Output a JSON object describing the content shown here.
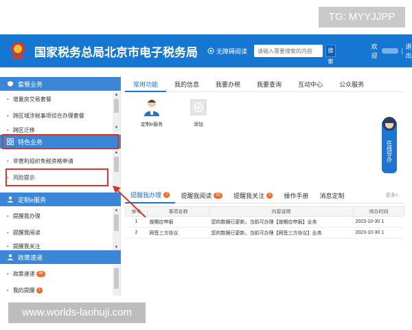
{
  "watermark_top": "TG: MYYJJPP",
  "watermark_bottom": "www.worlds-laohuji.com",
  "header": {
    "title": "国家税务总局北京市电子税务局",
    "barrier_free": "无障碍阅读",
    "search_placeholder": "请输入需要搜索的内容",
    "search_button": "搜索",
    "welcome": "欢迎",
    "separator": "|",
    "logout": "退出",
    "color": "#1677d2"
  },
  "sidebar": {
    "sections": [
      {
        "title": "套餐业务",
        "icon": "shield-icon",
        "items": [
          {
            "label": "增量房交易套餐"
          },
          {
            "label": "跨区域涉税事项综合办理套餐"
          },
          {
            "label": "跨区迁移"
          }
        ]
      },
      {
        "title": "特色业务",
        "icon": "grid-icon",
        "items": [
          {
            "label": "非营利组织免税资格申请"
          },
          {
            "label": "风险提示"
          }
        ]
      },
      {
        "title": "定制e服务",
        "icon": "user-icon",
        "items": [
          {
            "label": "提醒我办理"
          },
          {
            "label": "提醒我阅读"
          },
          {
            "label": "提醒我关注"
          }
        ]
      },
      {
        "title": "政策速递",
        "icon": "user-icon",
        "items": [
          {
            "label": "政策速递",
            "badge": "46"
          },
          {
            "label": "我的提醒",
            "badge": "1"
          }
        ]
      }
    ]
  },
  "main": {
    "tabs": [
      "常用功能",
      "我的信息",
      "我要办税",
      "我要查询",
      "互动中心",
      "公众服务"
    ],
    "functions": [
      {
        "label": "定制e服务",
        "icon": "person-service-icon"
      },
      {
        "label": "添加",
        "icon": "plus-icon"
      }
    ],
    "online_service": "在线导办",
    "msg_tabs": [
      {
        "label": "提醒我办理",
        "count": "2"
      },
      {
        "label": "提醒我阅读",
        "count": "50"
      },
      {
        "label": "提醒我关注",
        "count": "1"
      },
      {
        "label": "操作手册"
      },
      {
        "label": "消息定制"
      }
    ],
    "more": "更多>",
    "table": {
      "headers": [
        "序号",
        "事项名称",
        "内容说明",
        "待办时间"
      ],
      "rows": [
        [
          "1",
          "按期应申报",
          "您的数据已更新，当前可办理【按期应申报】业务",
          "2023-10-30 1"
        ],
        [
          "2",
          "网签三方协议",
          "您的数据已更新，当前可办理【网签三方协议】业务",
          "2023-10-30 1"
        ]
      ]
    }
  }
}
